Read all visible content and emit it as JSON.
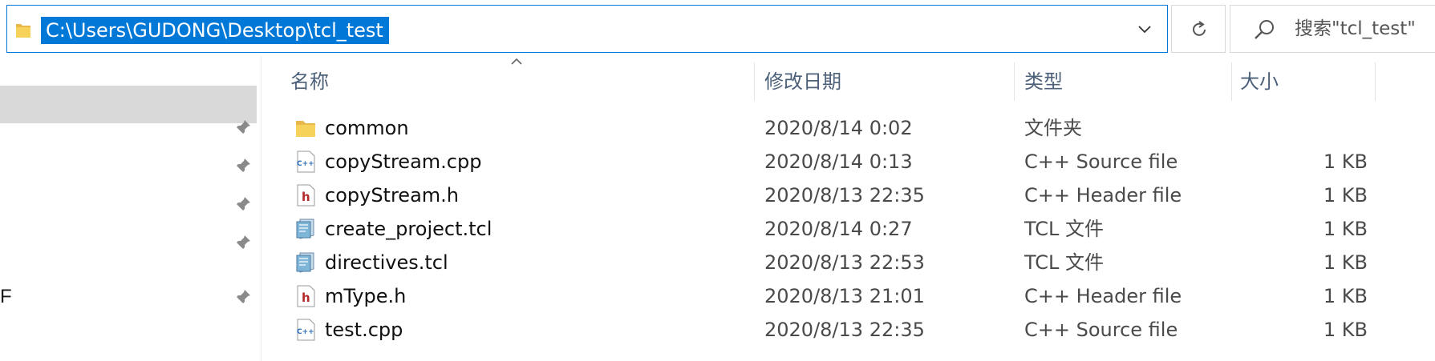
{
  "address_bar": {
    "path": "C:\\Users\\GUDONG\\Desktop\\tcl_test"
  },
  "search": {
    "placeholder": "搜索\"tcl_test\""
  },
  "nav_pane": {
    "partial_label": "F"
  },
  "columns": {
    "name": "名称",
    "date": "修改日期",
    "type": "类型",
    "size": "大小"
  },
  "files": [
    {
      "name": "common",
      "date": "2020/8/14 0:02",
      "type": "文件夹",
      "size": "",
      "icon": "folder-icon"
    },
    {
      "name": "copyStream.cpp",
      "date": "2020/8/14 0:13",
      "type": "C++ Source file",
      "size": "1 KB",
      "icon": "cpp-file-icon"
    },
    {
      "name": "copyStream.h",
      "date": "2020/8/13 22:35",
      "type": "C++ Header file",
      "size": "1 KB",
      "icon": "header-file-icon"
    },
    {
      "name": "create_project.tcl",
      "date": "2020/8/14 0:27",
      "type": "TCL 文件",
      "size": "1 KB",
      "icon": "tcl-file-icon"
    },
    {
      "name": "directives.tcl",
      "date": "2020/8/13 22:53",
      "type": "TCL 文件",
      "size": "1 KB",
      "icon": "tcl-file-icon"
    },
    {
      "name": "mType.h",
      "date": "2020/8/13 21:01",
      "type": "C++ Header file",
      "size": "1 KB",
      "icon": "header-file-icon"
    },
    {
      "name": "test.cpp",
      "date": "2020/8/13 22:35",
      "type": "C++ Source file",
      "size": "1 KB",
      "icon": "cpp-file-icon"
    }
  ],
  "colors": {
    "selection": "#0078d7",
    "nav_selected": "#d9d9d9",
    "header_text": "#4c607a"
  }
}
